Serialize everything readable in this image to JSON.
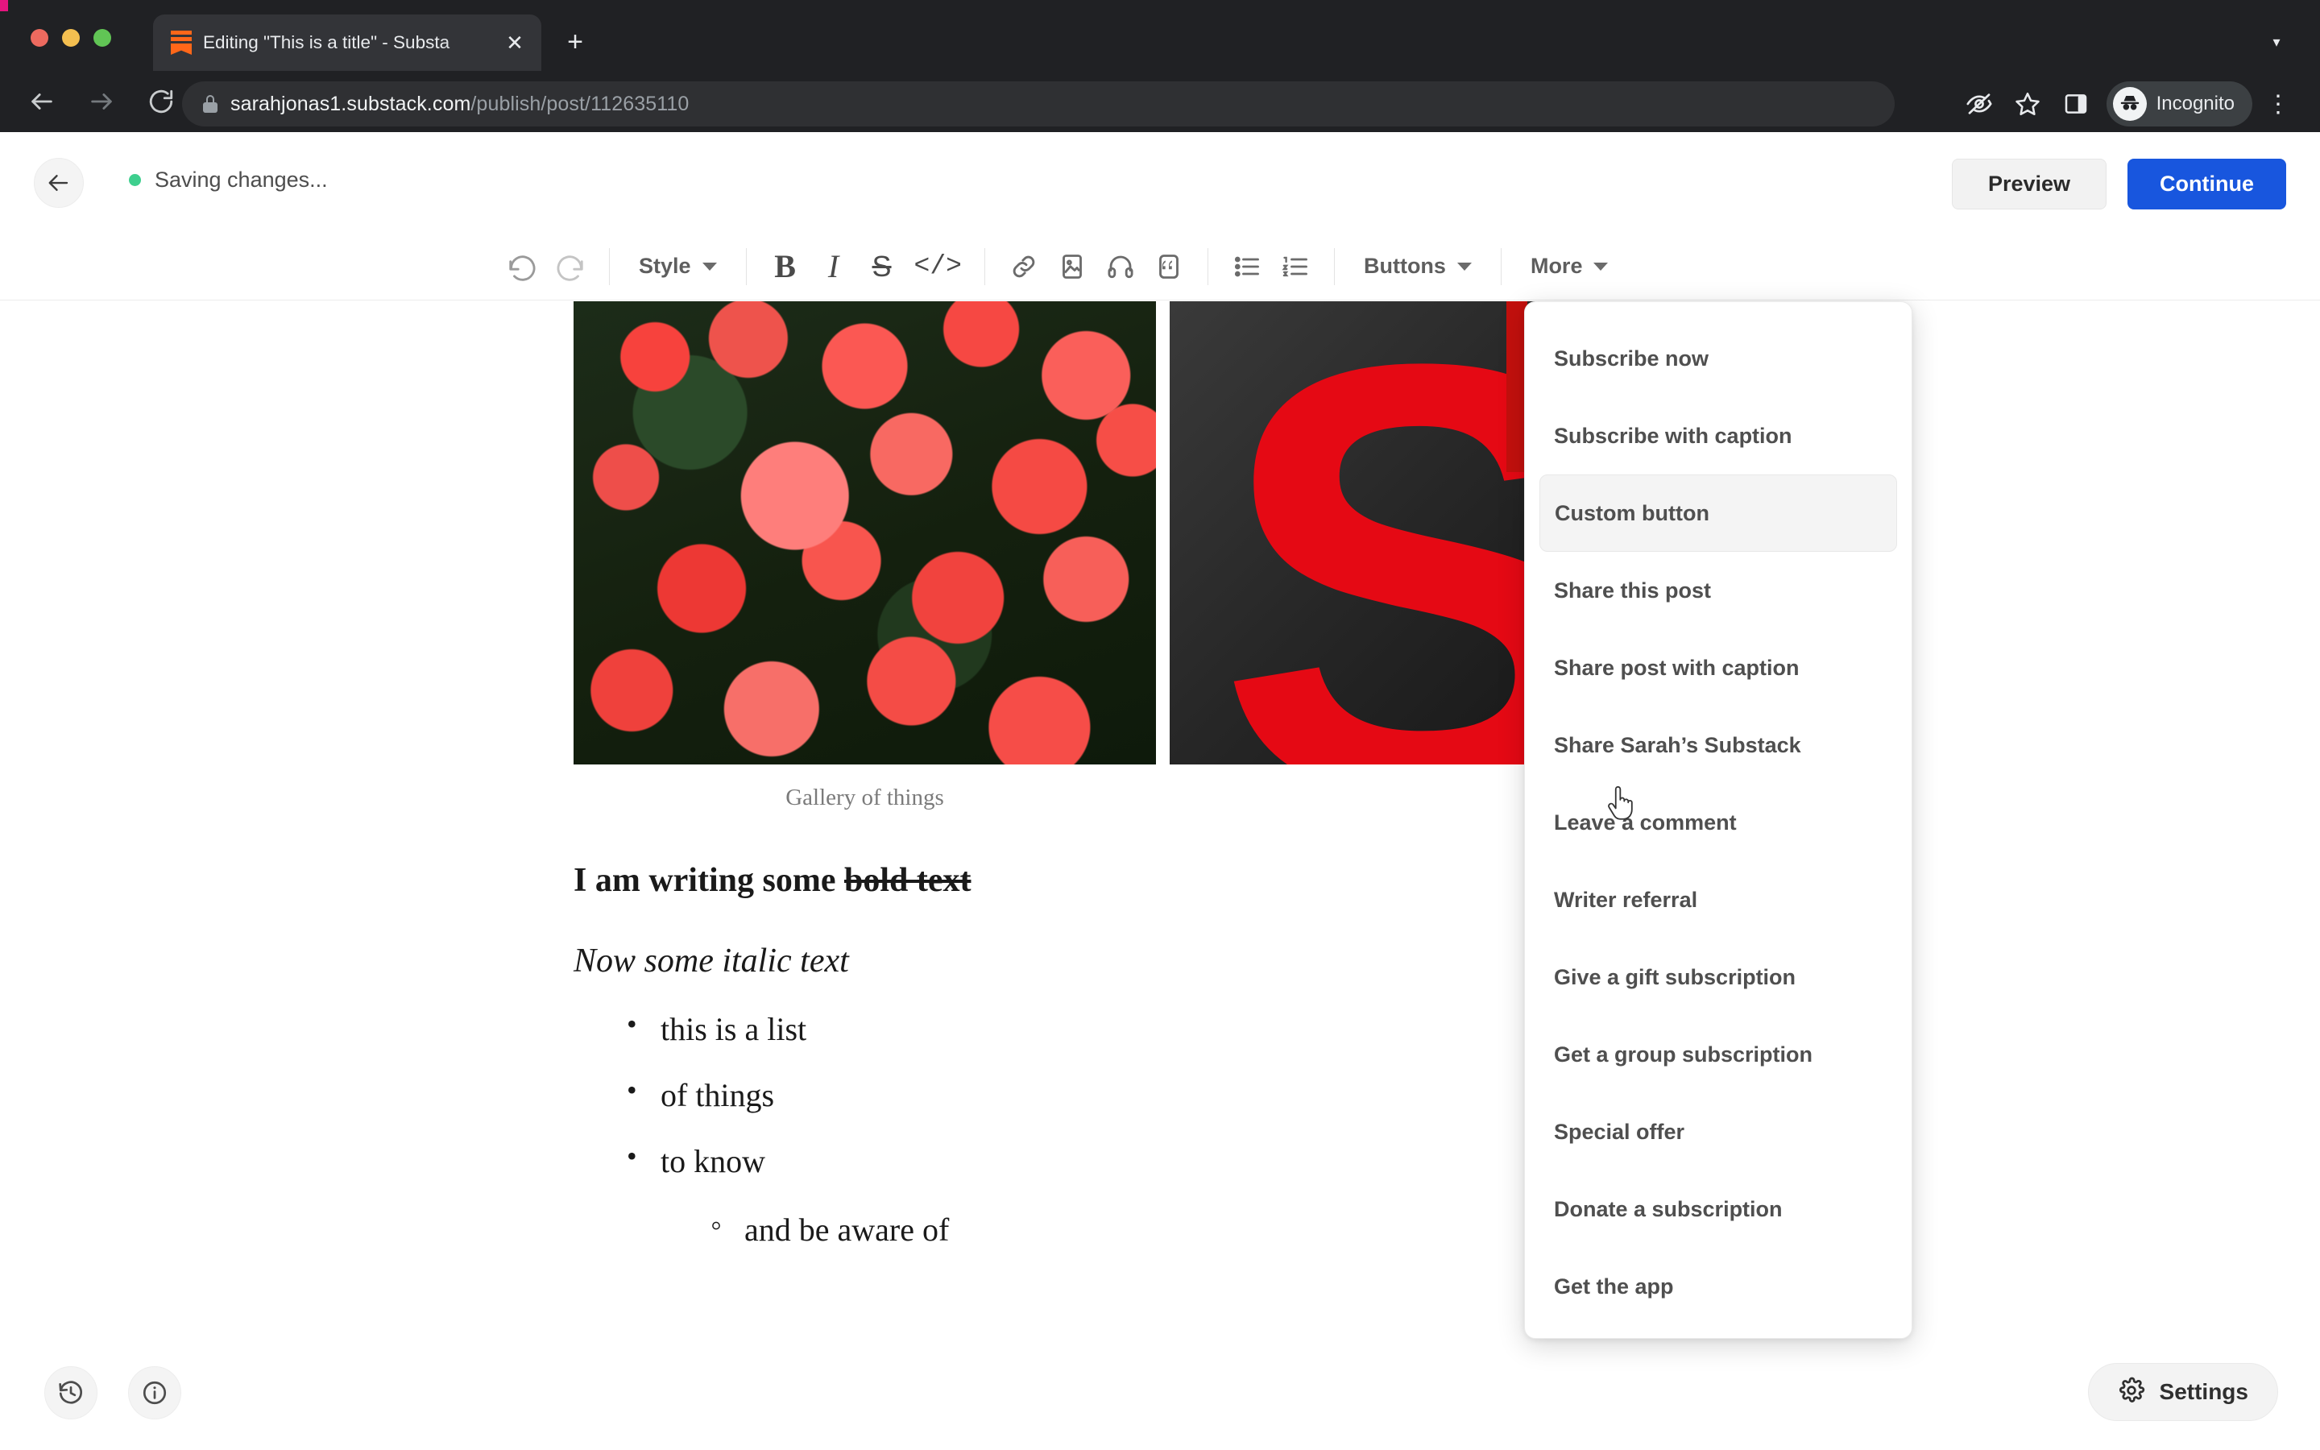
{
  "browser": {
    "tab": {
      "title": "Editing \"This is a title\" - Substa",
      "favicon": "substack-favicon",
      "close_label": "✕"
    },
    "new_tab_label": "+",
    "tab_list_chevron": "▾",
    "nav": {
      "back": "←",
      "forward": "→",
      "reload": "↻"
    },
    "omnibox": {
      "domain": "sarahjonas1.substack.com",
      "path": "/publish/post/112635110",
      "lock_icon": "lock-icon"
    },
    "actions": {
      "tracking_protection": "eye-slash-icon",
      "bookmark": "star-icon",
      "side_panel": "side-panel-icon",
      "profile_label": "Incognito",
      "menu": "⋮"
    }
  },
  "app_header": {
    "back_label": "←",
    "status_text": "Saving changes...",
    "status_color": "#3ecf8e",
    "preview_label": "Preview",
    "continue_label": "Continue",
    "continue_color": "#1856de"
  },
  "toolbar": {
    "undo": "undo-icon",
    "redo": "redo-icon",
    "style_label": "Style",
    "bold": "B",
    "italic": "I",
    "strikethrough": "S",
    "code": "</>",
    "link": "link-icon",
    "image": "image-icon",
    "audio": "audio-icon",
    "quote": "quote-icon",
    "bullet_list": "bullet-list-icon",
    "numbered_list": "numbered-list-icon",
    "buttons_label": "Buttons",
    "more_label": "More"
  },
  "editor": {
    "gallery": {
      "images": [
        {
          "alt": "red begonia flowers"
        },
        {
          "alt": "substack red S on dark background"
        }
      ],
      "caption": "Gallery of things"
    },
    "paragraph_bold": {
      "plain": "I am writing some ",
      "struck": "bold text"
    },
    "paragraph_italic": "Now some italic text",
    "list": [
      "this is a list",
      "of things",
      "to know"
    ],
    "sublist": [
      "and be aware of"
    ]
  },
  "buttons_menu": {
    "items": [
      {
        "label": "Subscribe now",
        "active": false
      },
      {
        "label": "Subscribe with caption",
        "active": false
      },
      {
        "label": "Custom button",
        "active": true
      },
      {
        "label": "Share this post",
        "active": false
      },
      {
        "label": "Share post with caption",
        "active": false
      },
      {
        "label": "Share Sarah’s Substack",
        "active": false
      },
      {
        "label": "Leave a comment",
        "active": false
      },
      {
        "label": "Writer referral",
        "active": false
      },
      {
        "label": "Give a gift subscription",
        "active": false
      },
      {
        "label": "Get a group subscription",
        "active": false
      },
      {
        "label": "Special offer",
        "active": false
      },
      {
        "label": "Donate a subscription",
        "active": false
      },
      {
        "label": "Get the app",
        "active": false
      }
    ]
  },
  "footer": {
    "history_icon": "history-clock-icon",
    "info_icon": "info-icon",
    "settings_label": "Settings",
    "settings_icon": "gear-icon"
  }
}
